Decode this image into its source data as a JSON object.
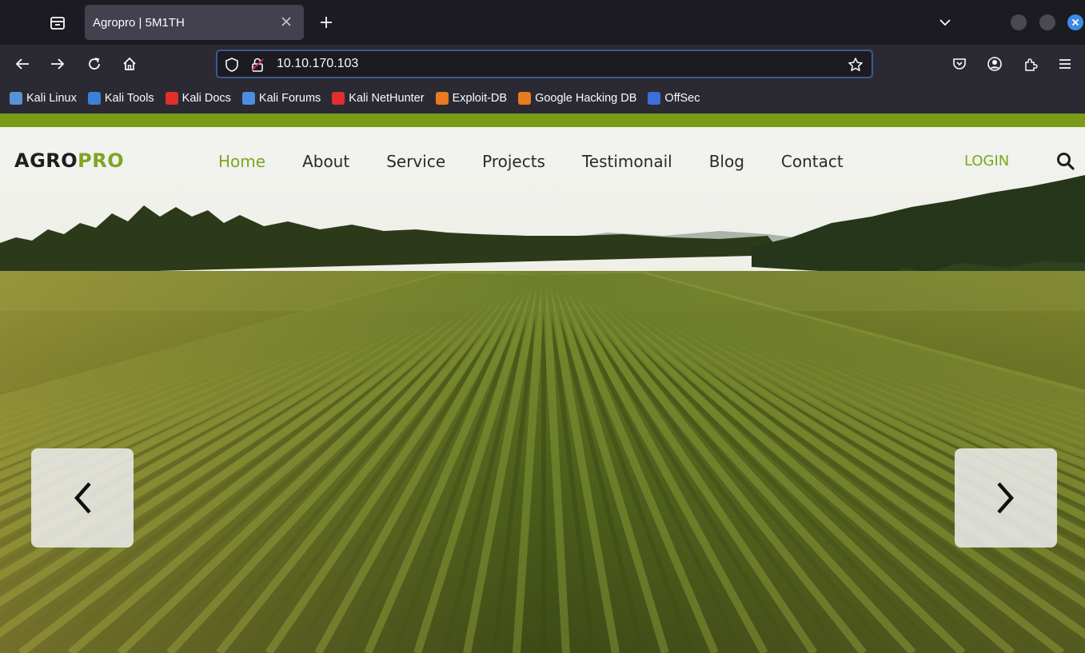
{
  "browser": {
    "tab_title": "Agropro | 5M1TH",
    "url": "10.10.170.103",
    "bookmarks": [
      {
        "label": "Kali Linux",
        "color": "#5c8fd6"
      },
      {
        "label": "Kali Tools",
        "color": "#3b7fd9"
      },
      {
        "label": "Kali Docs",
        "color": "#e0302b"
      },
      {
        "label": "Kali Forums",
        "color": "#4a8fe0"
      },
      {
        "label": "Kali NetHunter",
        "color": "#e0302b"
      },
      {
        "label": "Exploit-DB",
        "color": "#e87b22"
      },
      {
        "label": "Google Hacking DB",
        "color": "#e87b22"
      },
      {
        "label": "OffSec",
        "color": "#3b6fd9"
      }
    ]
  },
  "site": {
    "logo_part1": "AGRO",
    "logo_part2": "PRO",
    "accent": "#7ca623",
    "menu": [
      "Home",
      "About",
      "Service",
      "Projects",
      "Testimonail",
      "Blog",
      "Contact"
    ],
    "active_menu": "Home",
    "login_label": "LOGIN"
  }
}
